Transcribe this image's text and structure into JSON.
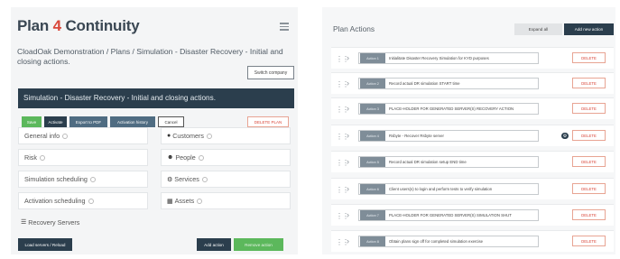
{
  "logo": {
    "prefix": "Plan",
    "number": "4",
    "suffix": "Continuity"
  },
  "breadcrumb": "CloadOak Demonstration / Plans / Simulation - Disaster Recovery - Initial and closing actions.",
  "select_company_label": "Switch company",
  "simulation_header": "Simulation - Disaster Recovery - Initial and closing actions.",
  "toolbar": {
    "save": "Save",
    "activate": "Activate",
    "export": "Export to PDF",
    "history": "Activation history",
    "cancel": "Cancel",
    "delete_plan": "DELETE PLAN"
  },
  "tiles": {
    "general_info": "General info",
    "customers": "Customers",
    "risk": "Risk",
    "people": "People",
    "simulation_scheduling": "Simulation scheduling",
    "services": "Services",
    "activation_scheduling": "Activation scheduling",
    "assets": "Assets",
    "recovery_servers": "Recovery Servers"
  },
  "bottom_buttons": {
    "load_servers": "Load servers / Reload",
    "add_action": "Add action",
    "remove_action": "Remove action"
  },
  "plan_actions": {
    "title": "Plan Actions",
    "expand_all": "Expand all",
    "add_new_action": "Add new action",
    "delete_label": "DELETE",
    "items": [
      {
        "tag": "Action 1",
        "text": "Initialitate Disaster Recovery Simulation for KYD purposes"
      },
      {
        "tag": "Action 2",
        "text": "Record actual DR simulation START time"
      },
      {
        "tag": "Action 3",
        "text": "PLACE-HOLDER FOR GENERATED SERVER(S) RECOVERY ACTION"
      },
      {
        "tag": "Action 4",
        "text": "Rsbyte - Recover Rsbyte server",
        "has_gear": true
      },
      {
        "tag": "Action 5",
        "text": "Record actual DR simulation setup END time"
      },
      {
        "tag": "Action 6",
        "text": "Client users(s) to login and perform tests to verify simulation"
      },
      {
        "tag": "Action 7",
        "text": "PLACE-HOLDER FOR GENERATED SERVER(S) SIMULATION SHUT"
      },
      {
        "tag": "Action 8",
        "text": "Obtain plans sign off for completed simulation exercise"
      }
    ]
  },
  "icons": {
    "customers": "map-marker-icon",
    "people": "person-icon",
    "services": "gear-icon",
    "assets": "building-icon",
    "recovery_servers": "server-icon",
    "grip": "drag-handle-icon",
    "chevron": "chevron-right-icon"
  },
  "colors": {
    "navy": "#2b3e4d",
    "green": "#5cb85c",
    "red": "#d9473a"
  }
}
